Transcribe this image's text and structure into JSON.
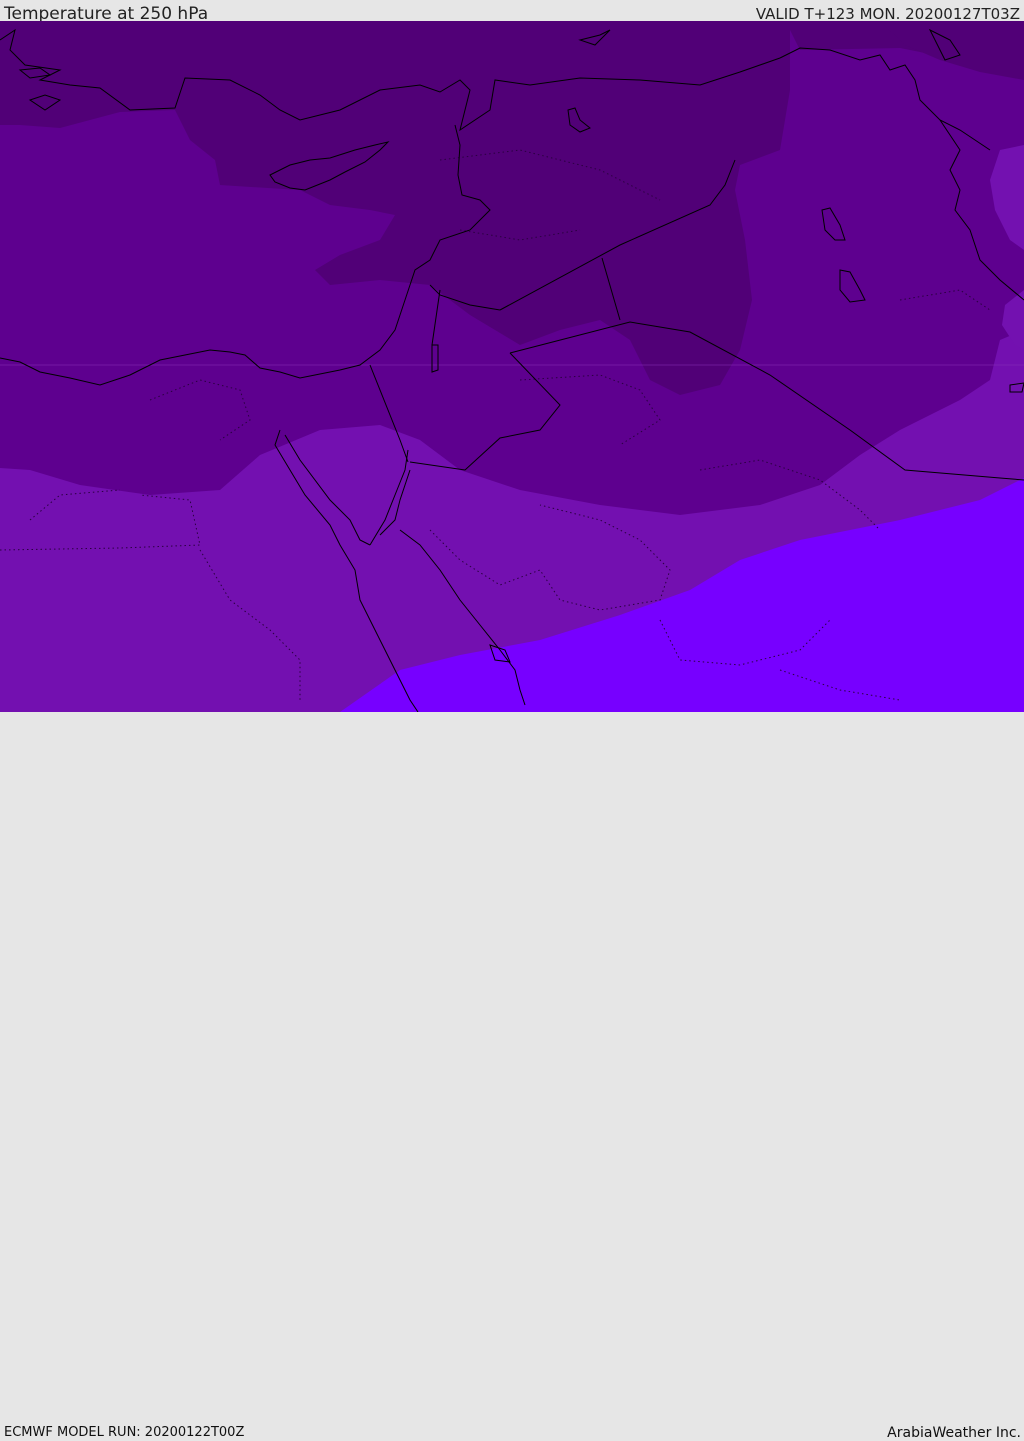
{
  "header": {
    "title": "Temperature at 250 hPa",
    "valid": "VALID T+123 MON. 20200127T03Z"
  },
  "footer": {
    "model_run": "ECMWF MODEL RUN: 20200122T00Z",
    "brand": "ArabiaWeather Inc."
  },
  "map": {
    "variable": "temperature",
    "level": "250 hPa",
    "color_bands": [
      "#4e007a",
      "#5f0090",
      "#7311b0",
      "#7800ff"
    ],
    "coastline_color": "#000000",
    "border_style": "solid",
    "contour_style": "dotted"
  }
}
